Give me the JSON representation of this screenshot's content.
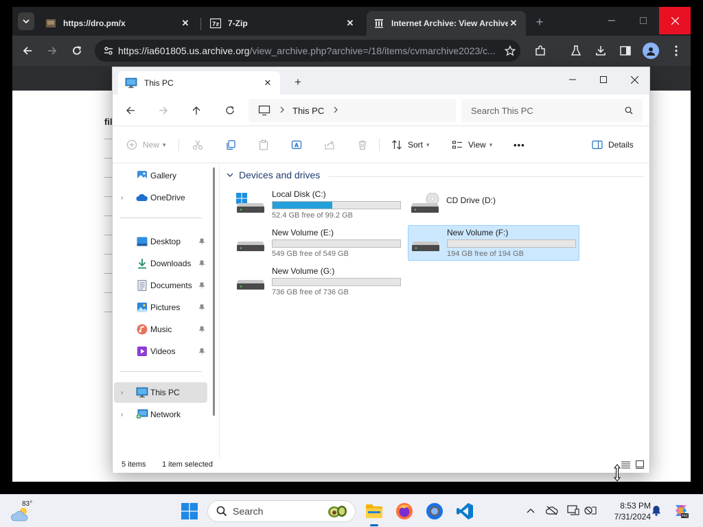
{
  "browser": {
    "tabs": [
      {
        "title": "https://dro.pm/x",
        "close": "✕"
      },
      {
        "title": "7-Zip",
        "close": "✕"
      },
      {
        "title": "Internet Archive: View Archive",
        "close": "✕"
      }
    ],
    "url_host": "https://ia601805.us.archive.org",
    "url_path": "/view_archive.php?archive=/18/items/cvmarchive2023/c...",
    "new_tab": "+"
  },
  "background_page": {
    "fragment": "fil"
  },
  "explorer": {
    "tab_title": "This PC",
    "tab_close": "✕",
    "new_tab": "+",
    "breadcrumb": "This PC",
    "search_placeholder": "Search This PC",
    "commands": {
      "new": "New",
      "sort": "Sort",
      "view": "View",
      "more": "•••",
      "details": "Details"
    },
    "sidebar": {
      "gallery": "Gallery",
      "onedrive": "OneDrive",
      "desktop": "Desktop",
      "downloads": "Downloads",
      "documents": "Documents",
      "pictures": "Pictures",
      "music": "Music",
      "videos": "Videos",
      "this_pc": "This PC",
      "network": "Network"
    },
    "group_title": "Devices and drives",
    "drives": [
      {
        "name": "Local Disk (C:)",
        "free": "52.4 GB free of 99.2 GB",
        "used_fraction": 0.47,
        "has_bar": true,
        "selected": false
      },
      {
        "name": "CD Drive (D:)",
        "free": "",
        "used_fraction": 0,
        "has_bar": false,
        "selected": false
      },
      {
        "name": "New Volume (E:)",
        "free": "549 GB free of 549 GB",
        "used_fraction": 0,
        "has_bar": true,
        "selected": false
      },
      {
        "name": "New Volume (F:)",
        "free": "194 GB free of 194 GB",
        "used_fraction": 0,
        "has_bar": true,
        "selected": true
      },
      {
        "name": "New Volume (G:)",
        "free": "736 GB free of 736 GB",
        "used_fraction": 0,
        "has_bar": true,
        "selected": false
      }
    ],
    "status": {
      "items": "5 items",
      "selected": "1 item selected"
    }
  },
  "taskbar": {
    "temperature": "83°",
    "search_label": "Search",
    "time": "8:53 PM",
    "date": "7/31/2024"
  },
  "colors": {
    "accent": "#0067c0",
    "drive_bar": "#26a0da",
    "selection": "#cce8ff",
    "chrome_bg": "#202124",
    "close_red": "#e81123"
  }
}
